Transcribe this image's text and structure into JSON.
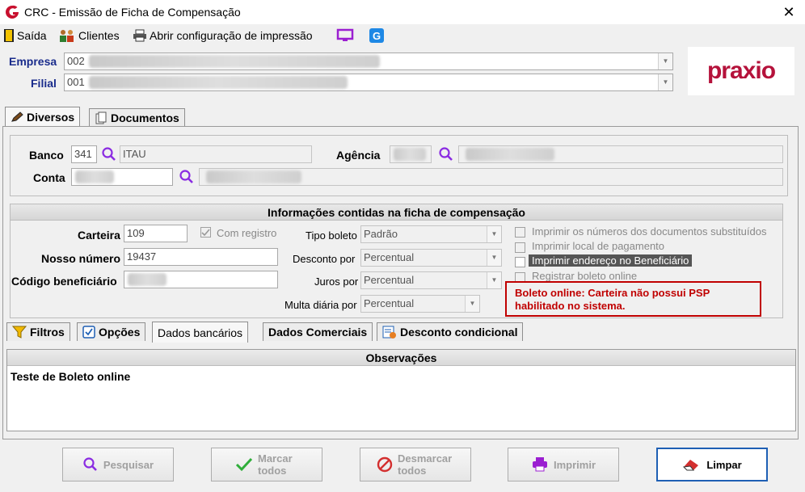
{
  "window": {
    "title": "CRC - Emissão de Ficha de Compensação"
  },
  "toolbar": {
    "saida": "Saída",
    "clientes": "Clientes",
    "print_config": "Abrir configuração de impressão"
  },
  "header": {
    "empresa_label": "Empresa",
    "empresa_value": "002",
    "filial_label": "Filial",
    "filial_value": "001",
    "brand": "praxio"
  },
  "top_tabs": {
    "diversos": "Diversos",
    "documentos": "Documentos"
  },
  "bank": {
    "banco_label": "Banco",
    "banco_code": "341",
    "banco_name": "ITAU",
    "agencia_label": "Agência",
    "conta_label": "Conta"
  },
  "section_title": "Informações contidas na ficha de compensação",
  "fields": {
    "carteira_label": "Carteira",
    "carteira_value": "109",
    "com_registro": "Com registro",
    "nosso_numero_label": "Nosso número",
    "nosso_numero_value": "19437",
    "codigo_beneficiario_label": "Código beneficiário",
    "tipo_boleto_label": "Tipo boleto",
    "tipo_boleto_value": "Padrão",
    "desconto_label": "Desconto por",
    "desconto_value": "Percentual",
    "juros_label": "Juros por",
    "juros_value": "Percentual",
    "multa_label": "Multa diária por",
    "multa_value": "Percentual"
  },
  "checkboxes": {
    "imprimir_numeros": "Imprimir os números dos documentos substituídos",
    "imprimir_local": "Imprimir local de pagamento",
    "imprimir_endereco": "Imprimir endereço no Beneficiário",
    "registrar_online": "Registrar boleto online"
  },
  "warning": "Boleto online: Carteira não possui PSP habilitado no sistema.",
  "bottom_tabs": {
    "filtros": "Filtros",
    "opcoes": "Opções",
    "dados_bancarios": "Dados bancários",
    "dados_comerciais": "Dados Comerciais",
    "desconto_condicional": "Desconto condicional"
  },
  "observacoes": {
    "title": "Observações",
    "text": "Teste de Boleto online"
  },
  "buttons": {
    "pesquisar": "Pesquisar",
    "marcar": "Marcar todos",
    "desmarcar": "Desmarcar todos",
    "imprimir": "Imprimir",
    "limpar": "Limpar"
  },
  "colors": {
    "brand": "#b5123b",
    "label_blue": "#1a2c8c",
    "warning_red": "#c00000",
    "icon_purple": "#8a2be2"
  }
}
